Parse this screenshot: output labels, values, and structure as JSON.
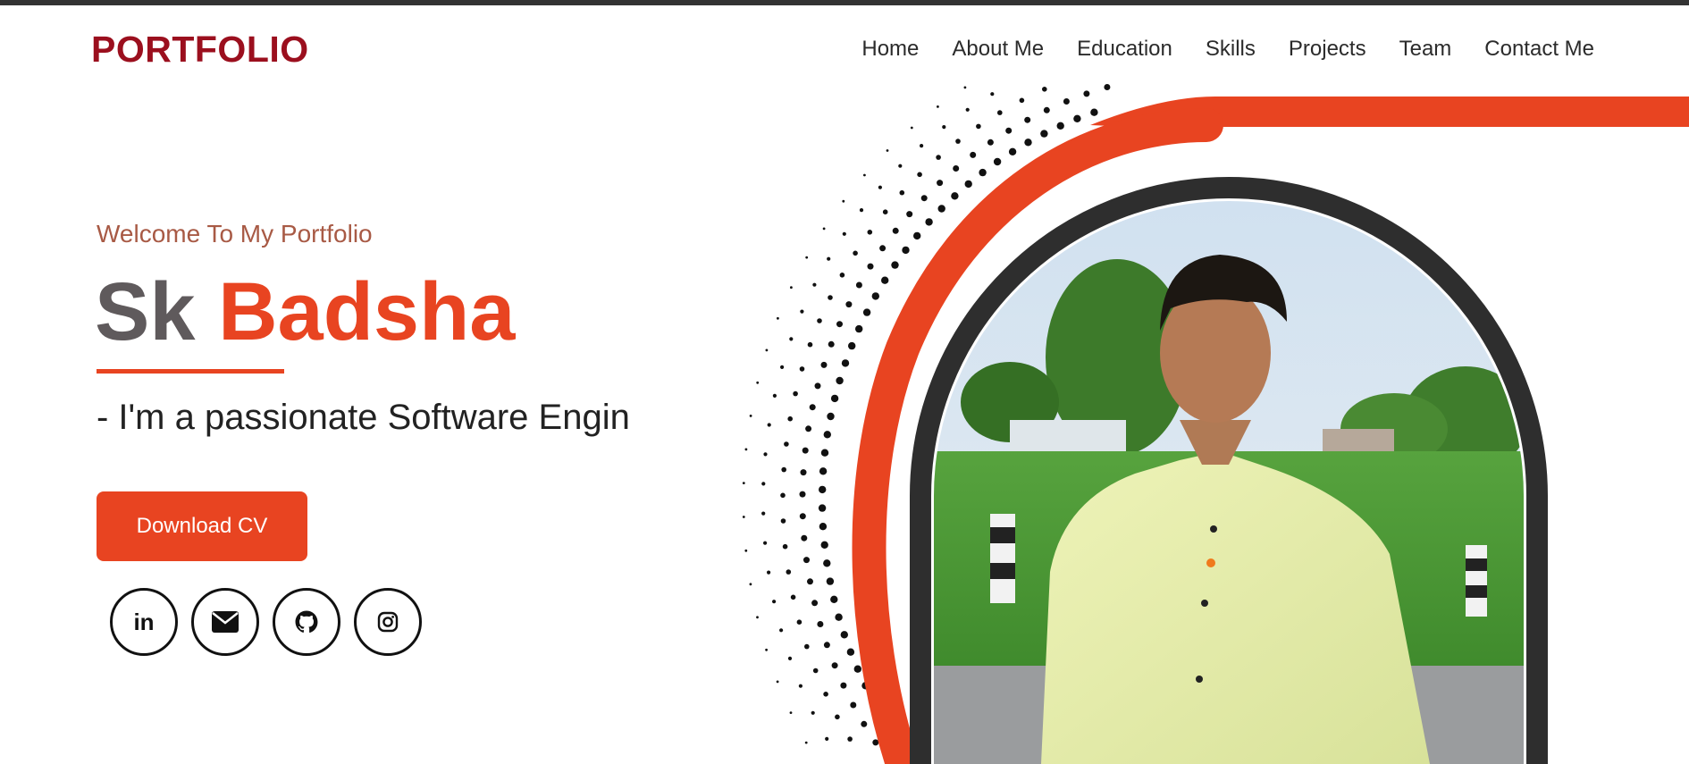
{
  "header": {
    "logo": "PORTFOLIO",
    "nav": [
      {
        "label": "Home"
      },
      {
        "label": "About Me"
      },
      {
        "label": "Education"
      },
      {
        "label": "Skills"
      },
      {
        "label": "Projects"
      },
      {
        "label": "Team"
      },
      {
        "label": "Contact Me"
      }
    ]
  },
  "hero": {
    "welcome": "Welcome To My Portfolio",
    "first_name": "Sk",
    "last_name": "Badsha",
    "tagline": "- I'm a passionate Software Engin",
    "cta_label": "Download CV",
    "socials": [
      {
        "icon": "linkedin-icon",
        "glyph": "in"
      },
      {
        "icon": "envelope-icon"
      },
      {
        "icon": "github-icon"
      },
      {
        "icon": "instagram-icon"
      }
    ]
  },
  "colors": {
    "accent": "#e84421",
    "logo": "#9b0f1e",
    "welcome": "#a85a45",
    "name_grey": "#5f5a5c",
    "frame_dark": "#2e2e2e"
  }
}
